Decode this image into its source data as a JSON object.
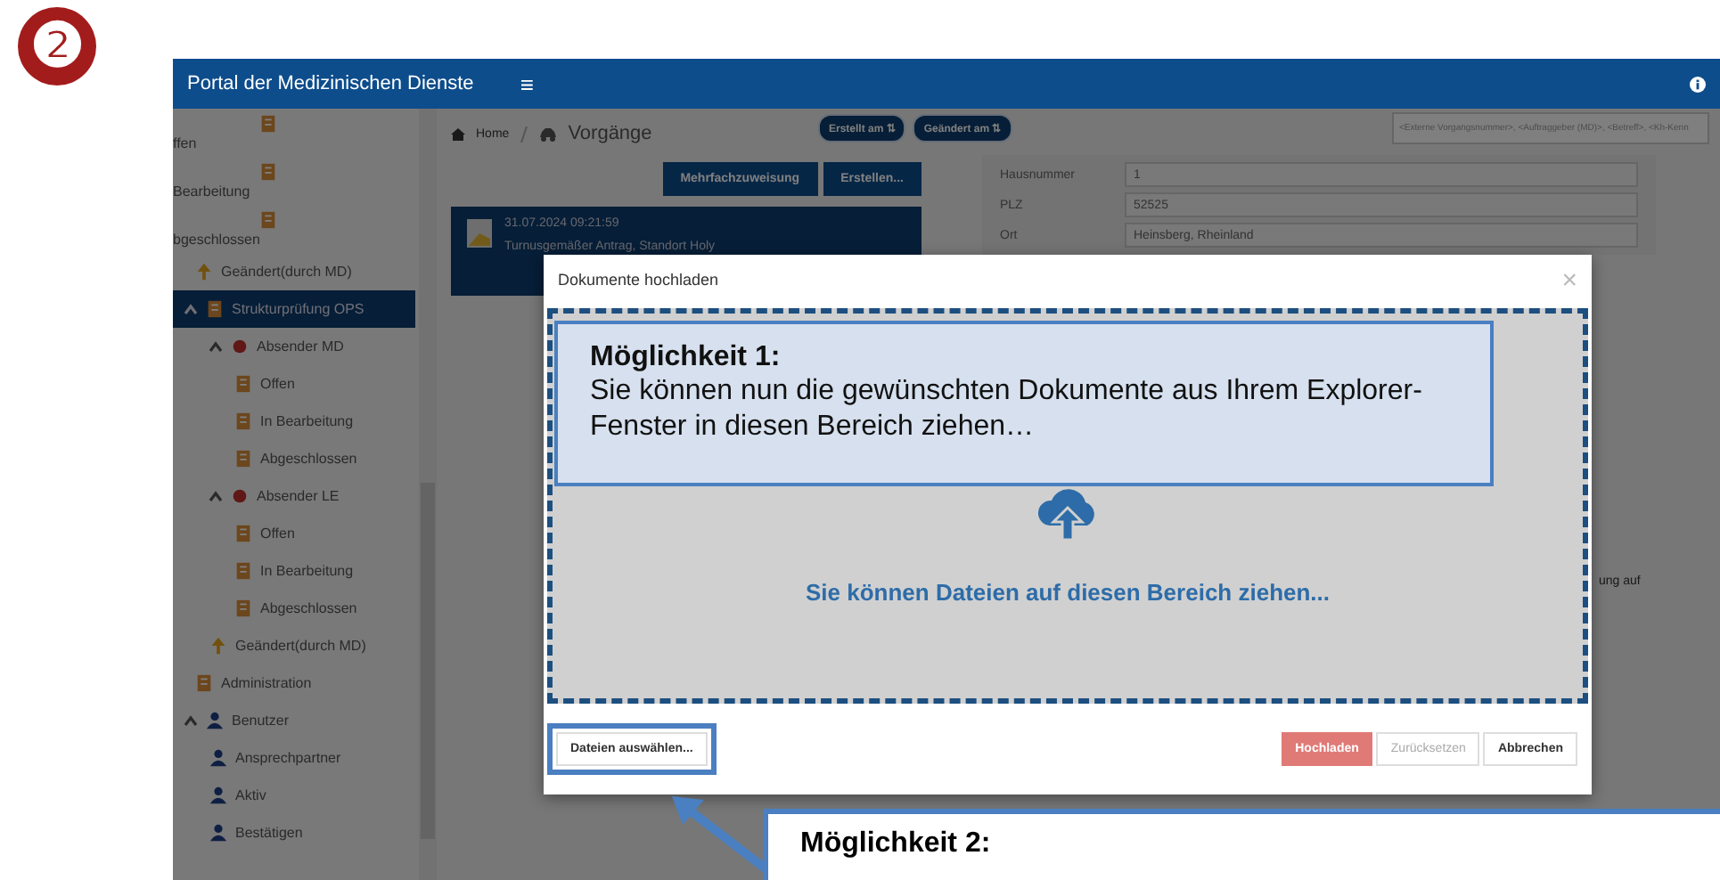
{
  "step_badge": "❷",
  "header": {
    "title": "Portal der Medizinischen Dienste",
    "menu_icon": "≡"
  },
  "sidebar": {
    "items": [
      {
        "label": "ffen",
        "kind": "doc",
        "selected": false
      },
      {
        "label": "Bearbeitung",
        "kind": "doc",
        "selected": false
      },
      {
        "label": "bgeschlossen",
        "kind": "doc",
        "selected": false
      },
      {
        "label": "Geändert(durch MD)",
        "kind": "changed",
        "selected": false
      },
      {
        "label": "Strukturprüfung OPS",
        "kind": "doc",
        "selected": true,
        "expanded": true,
        "children": [
          {
            "label": "Absender MD",
            "kind": "sender",
            "selected": false,
            "expanded": true,
            "children": [
              {
                "label": "Offen",
                "kind": "doc",
                "selected": false
              },
              {
                "label": "In Bearbeitung",
                "kind": "doc",
                "selected": false
              },
              {
                "label": "Abgeschlossen",
                "kind": "doc",
                "selected": false
              }
            ]
          },
          {
            "label": "Absender LE",
            "kind": "sender",
            "selected": false,
            "expanded": true,
            "children": [
              {
                "label": "Offen",
                "kind": "doc",
                "selected": false
              },
              {
                "label": "In Bearbeitung",
                "kind": "doc",
                "selected": false
              },
              {
                "label": "Abgeschlossen",
                "kind": "doc",
                "selected": false
              }
            ]
          },
          {
            "label": "Geändert(durch MD)",
            "kind": "changed",
            "selected": false
          }
        ]
      },
      {
        "label": "Administration",
        "kind": "doc",
        "selected": false
      },
      {
        "label": "Benutzer",
        "kind": "user",
        "selected": false,
        "expanded": true,
        "children": [
          {
            "label": "Ansprechpartner",
            "kind": "user",
            "selected": false
          },
          {
            "label": "Aktiv",
            "kind": "user",
            "selected": false
          },
          {
            "label": "Bestätigen",
            "kind": "user",
            "selected": false
          }
        ]
      }
    ]
  },
  "breadcrumb": [
    "Home",
    "Vorgänge"
  ],
  "sort_buttons": [
    "Erstellt am ⇅",
    "Geändert am ⇅"
  ],
  "search": {
    "placeholder": "<Externe Vorgangsnummer>, <Auftraggeber (MD)>, <Betreff>, <Kh-Kenn"
  },
  "actions": [
    "Mehrfachzuweisung",
    "Erstellen..."
  ],
  "cases": [
    {
      "date": "31.07.2024 09:21:59",
      "subject": "Turnusgemäßer Antrag, Standort Holy",
      "selected": true
    }
  ],
  "details": [
    {
      "label": "Hausnummer",
      "value": "1"
    },
    {
      "label": "PLZ",
      "value": "52525"
    },
    {
      "label": "Ort",
      "value": "Heinsberg, Rheinland"
    }
  ],
  "detail_fragment": "ung auf",
  "modal": {
    "title": "Dokumente hochladen",
    "close": "×",
    "drop_text": "Sie können Dateien auf diesen Bereich ziehen...",
    "choose_button": "Dateien auswählen...",
    "buttons": [
      {
        "label": "Hochladen",
        "kind": "primary"
      },
      {
        "label": "Zurücksetzen",
        "kind": "disabled"
      },
      {
        "label": "Abbrechen",
        "kind": "default"
      }
    ]
  },
  "notes": [
    {
      "title": "Möglichkeit 1:",
      "text": "Sie können nun die gewünschten Dokumente aus Ihrem Explorer-Fenster in diesen Bereich ziehen…"
    },
    {
      "title": "Möglichkeit 2:"
    }
  ]
}
